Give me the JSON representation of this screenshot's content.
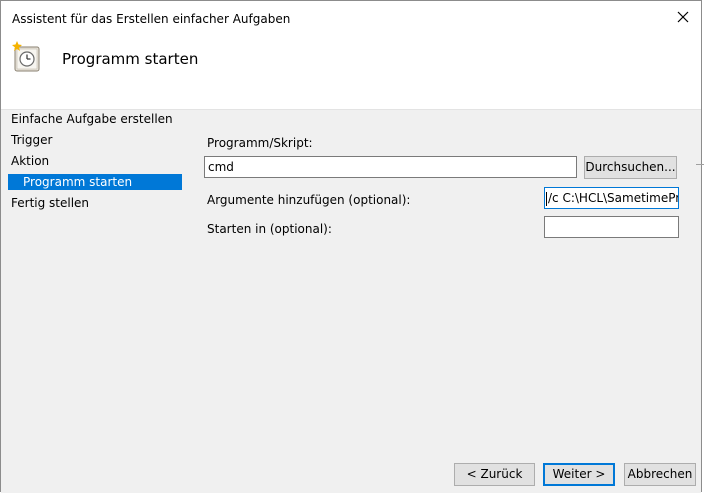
{
  "window": {
    "title": "Assistent für das Erstellen einfacher Aufgaben"
  },
  "header": {
    "title": "Programm starten"
  },
  "nav": {
    "items": [
      {
        "label": "Einfache Aufgabe erstellen"
      },
      {
        "label": "Trigger"
      },
      {
        "label": "Aktion"
      },
      {
        "label": "Programm starten"
      },
      {
        "label": "Fertig stellen"
      }
    ]
  },
  "form": {
    "program_label": "Programm/Skript:",
    "program_value": "cmd",
    "browse_label": "Durchsuchen...",
    "args_label": "Argumente hinzufügen (optional):",
    "args_value": "/c C:\\HCL\\SametimePro",
    "startin_label": "Starten in (optional):",
    "startin_value": ""
  },
  "footer": {
    "back_label": "< Zurück",
    "next_label": "Weiter >",
    "cancel_label": "Abbrechen"
  },
  "colors": {
    "accent": "#0078d7",
    "panel": "#f0f0f0"
  }
}
